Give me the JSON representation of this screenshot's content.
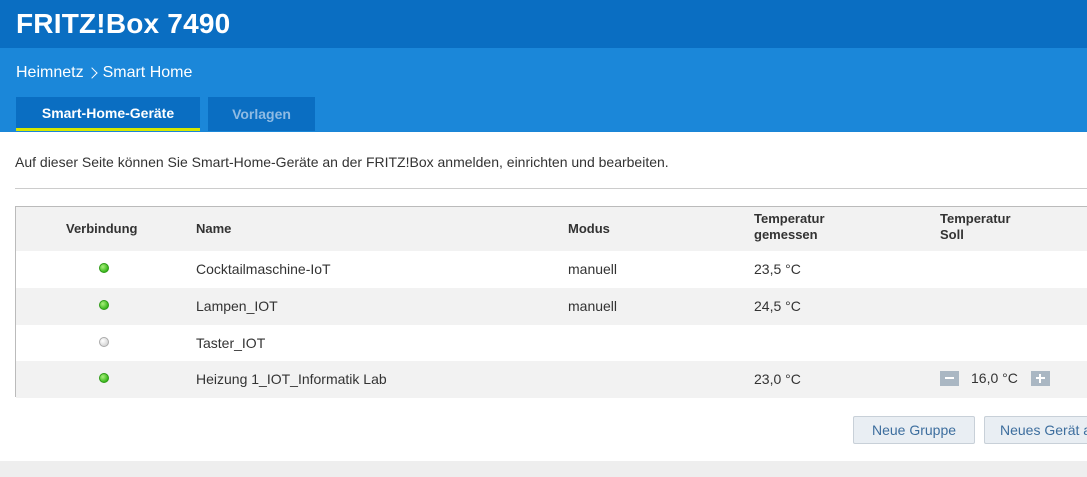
{
  "header": {
    "title": "FRITZ!Box 7490"
  },
  "breadcrumb": {
    "parent": "Heimnetz",
    "current": "Smart Home"
  },
  "tabs": [
    {
      "label": "Smart-Home-Geräte",
      "active": true
    },
    {
      "label": "Vorlagen",
      "active": false
    }
  ],
  "intro": "Auf dieser Seite können Sie Smart-Home-Geräte an der FRITZ!Box anmelden, einrichten und bearbeiten.",
  "table": {
    "headers": {
      "connection": "Verbindung",
      "name": "Name",
      "mode": "Modus",
      "temp_measured_1": "Temperatur",
      "temp_measured_2": "gemessen",
      "temp_target_1": "Temperatur",
      "temp_target_2": "Soll"
    },
    "rows": [
      {
        "connected": true,
        "name": "Cocktailmaschine-IoT",
        "mode": "manuell",
        "temp": "23,5 °C",
        "target": ""
      },
      {
        "connected": true,
        "name": "Lampen_IOT",
        "mode": "manuell",
        "temp": "24,5 °C",
        "target": ""
      },
      {
        "connected": false,
        "name": "Taster_IOT",
        "mode": "",
        "temp": "",
        "target": ""
      },
      {
        "connected": true,
        "name": "Heizung 1_IOT_Informatik Lab",
        "mode": "",
        "temp": "23,0 °C",
        "target": "16,0 °C"
      }
    ]
  },
  "buttons": {
    "new_group": "Neue Gruppe",
    "new_device": "Neues Gerät anmelden"
  },
  "colors": {
    "header_dark": "#0a6ec2",
    "header_light": "#1b87d9",
    "tab_indicator": "#d6e800",
    "led_on": "#3cb81e",
    "led_off": "#d8d8d8"
  }
}
